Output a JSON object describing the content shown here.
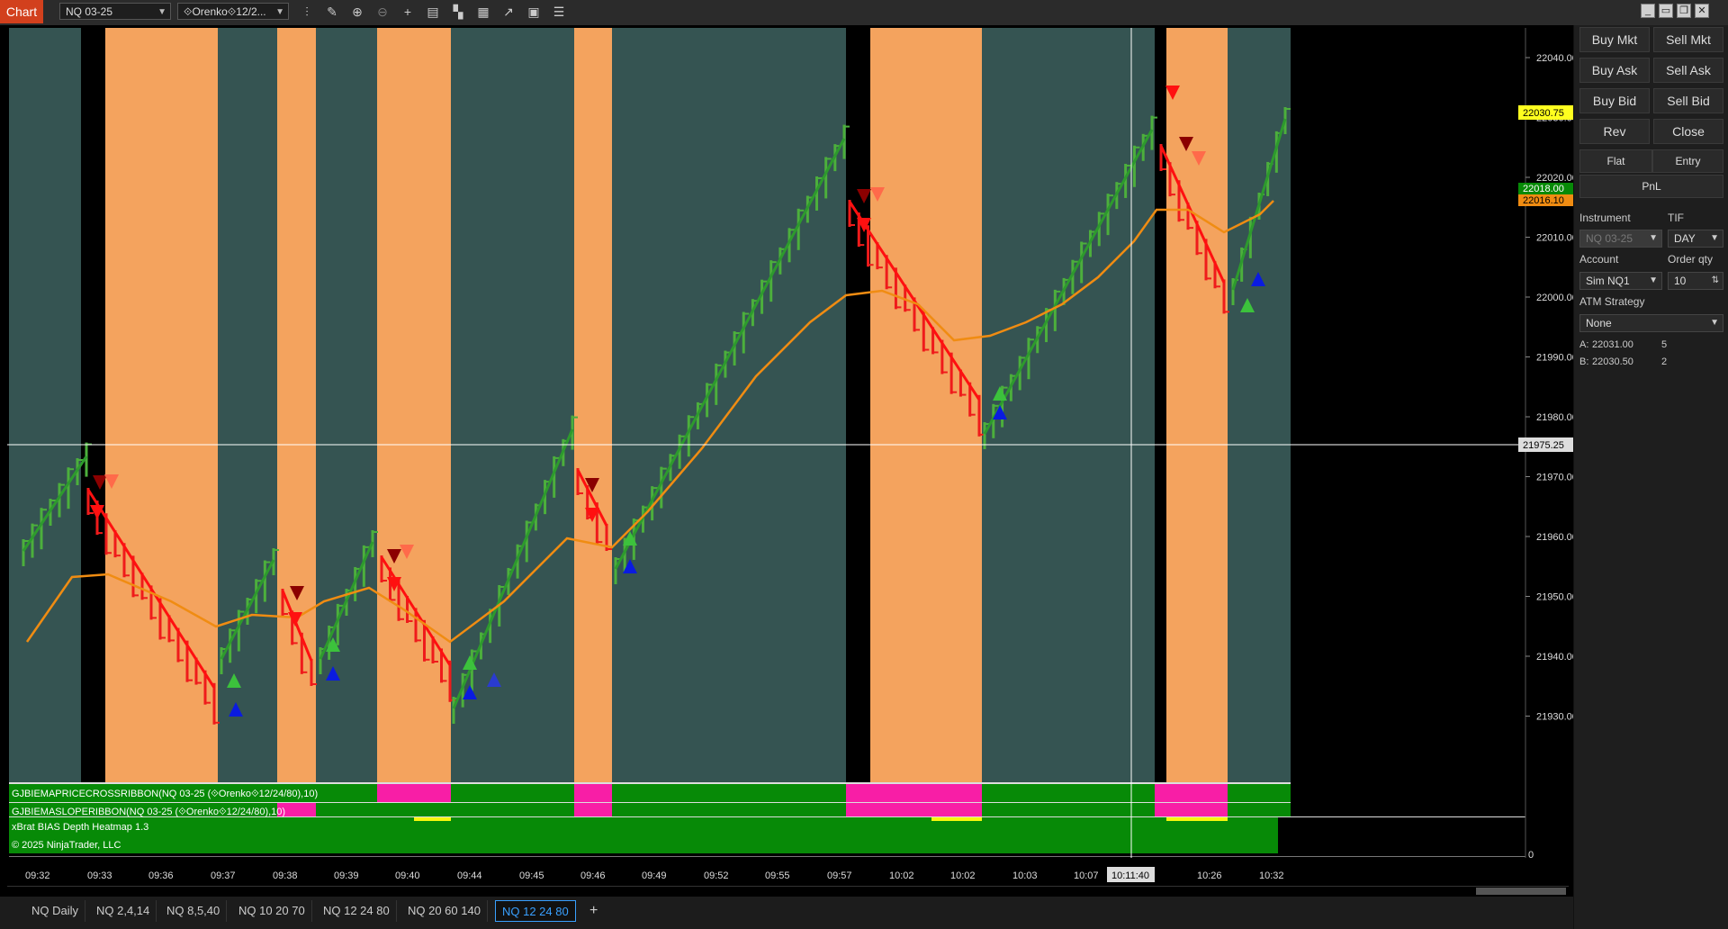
{
  "toolbar": {
    "tab_label": "Chart",
    "instrument": "NQ 03-25",
    "bars_type": "⟐Orenko⟐12/2...",
    "tool_icons": [
      "bar-style-icon",
      "pencil-icon",
      "zoom-in-icon",
      "zoom-out-icon",
      "crosshair-icon",
      "data-box-icon",
      "bar-type-icon",
      "strategies-icon",
      "indicators-icon",
      "properties-icon",
      "list-icon"
    ]
  },
  "window_controls": [
    "minimize-icon",
    "tile-icon",
    "restore-icon",
    "close-icon"
  ],
  "chart": {
    "price_labels": [
      "22040.00",
      "22030.00",
      "22020.00",
      "22010.00",
      "22000.00",
      "21990.00",
      "21980.00",
      "21970.00",
      "21960.00",
      "21950.00",
      "21940.00",
      "21930.00"
    ],
    "last_price": "22030.75",
    "ema_fast": "22018.00",
    "ema_slow": "22016.10",
    "cursor_price": "21975.25",
    "cursor_time": "10:11:40",
    "time_labels": [
      "09:32",
      "09:33",
      "09:36",
      "09:37",
      "09:38",
      "09:39",
      "09:40",
      "09:44",
      "09:45",
      "09:46",
      "09:49",
      "09:52",
      "09:55",
      "09:57",
      "10:02",
      "10:02",
      "10:03",
      "10:07",
      "11",
      "10:26",
      "10:32"
    ],
    "ribbon1_label": "GJBIEMAPRICECROSSRIBBON(NQ 03-25 (⟐Orenko⟐12/24/80),10)",
    "ribbon2_label": "GJBIEMASLOPERIBBON(NQ 03-25 (⟐Orenko⟐12/24/80),10)",
    "heatmap_label": "xBrat BIAS Depth Heatmap 1.3",
    "copyright": "© 2025 NinjaTrader, LLC",
    "heatmap_zero": "0",
    "colors": {
      "up": "#4caf3c",
      "down": "#ef1b1b",
      "ema": "#f08c12",
      "orange_zone": "#f4a35e",
      "teal_zone": "#355452",
      "ribbon_green": "#078a07",
      "ribbon_pink": "#f81ea6"
    }
  },
  "order_panel": {
    "buy_mkt": "Buy Mkt",
    "sell_mkt": "Sell Mkt",
    "buy_ask": "Buy Ask",
    "sell_ask": "Sell Ask",
    "buy_bid": "Buy Bid",
    "sell_bid": "Sell Bid",
    "rev": "Rev",
    "close": "Close",
    "flat": "Flat",
    "entry": "Entry",
    "pnl": "PnL",
    "instrument_label": "Instrument",
    "tif_label": "TIF",
    "instrument_value": "NQ 03-25",
    "tif_value": "DAY",
    "account_label": "Account",
    "order_qty_label": "Order qty",
    "account_value": "Sim NQ1",
    "order_qty_value": "10",
    "atm_label": "ATM Strategy",
    "atm_value": "None",
    "ask_label": "A:",
    "ask_price": "22031.00",
    "ask_size": "5",
    "bid_label": "B:",
    "bid_price": "22030.50",
    "bid_size": "2"
  },
  "bottom_tabs": [
    "NQ Daily",
    "NQ 2,4,14",
    "NQ 8,5,40",
    "NQ 10 20 70",
    "NQ 12 24 80",
    "NQ 20 60 140",
    "NQ 12 24 80"
  ],
  "active_tab_index": 6,
  "add_tab": "+"
}
